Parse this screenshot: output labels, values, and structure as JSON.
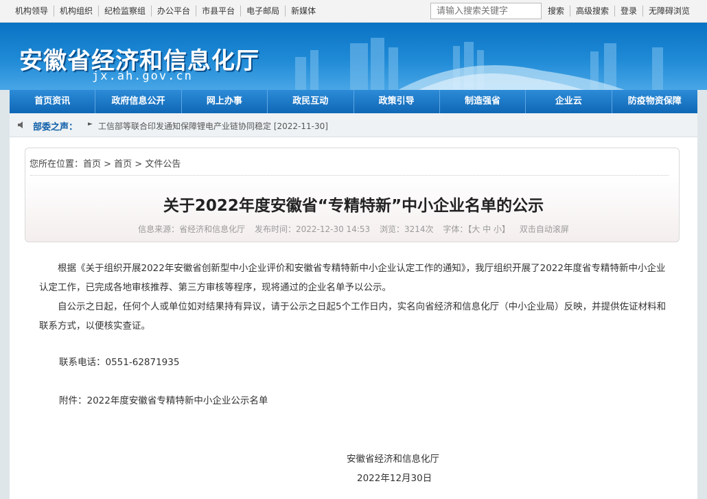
{
  "topbar": {
    "links": [
      "机构领导",
      "机构组织",
      "纪检监察组",
      "办公平台",
      "市县平台",
      "电子邮局",
      "新媒体"
    ],
    "search_placeholder": "请输入搜索关键字",
    "right_links": [
      "搜索",
      "高级搜索",
      "登录",
      "无障碍浏览"
    ]
  },
  "banner": {
    "title": "安徽省经济和信息化厅",
    "domain": "jx.ah.gov.cn"
  },
  "nav": [
    "首页资讯",
    "政府信息公开",
    "网上办事",
    "政民互动",
    "政策引导",
    "制造强省",
    "企业云",
    "防疫物资保障"
  ],
  "ticker": {
    "label": "部委之声：",
    "text": "工信部等联合印发通知保障锂电产业链协同稳定 [2022-11-30]"
  },
  "breadcrumb": "您所在位置：首页 > 首页 > 文件公告",
  "article": {
    "title": "关于2022年度安徽省“专精特新”中小企业名单的公示",
    "source": "信息来源：省经济和信息化厅",
    "time": "发布时间：2022-12-30 14:53",
    "views": "浏览：3214次",
    "font_size": "字体：【大 中 小】",
    "scroll": "双击自动滚屏",
    "para1": "根据《关于组织开展2022年安徽省创新型中小企业评价和安徽省专精特新中小企业认定工作的通知》，我厅组织开展了2022年度省专精特新中小企业认定工作，已完成各地审核推荐、第三方审核等程序，现将通过的企业名单予以公示。",
    "para2": "自公示之日起，任何个人或单位如对结果持有异议，请于公示之日起5个工作日内，实名向省经济和信息化厅（中小企业局）反映，并提供佐证材料和联系方式，以便核实查证。",
    "tel": "联系电话：0551-62871935",
    "attachment": "附件：2022年度安徽省专精特新中小企业公示名单",
    "sign_org": "安徽省经济和信息化厅",
    "sign_date": "2022年12月30日"
  },
  "colors": {
    "brand_blue": "#0f67b5",
    "banner_blue": "#1f8ad6",
    "ticker_label": "#0e5ea8"
  }
}
